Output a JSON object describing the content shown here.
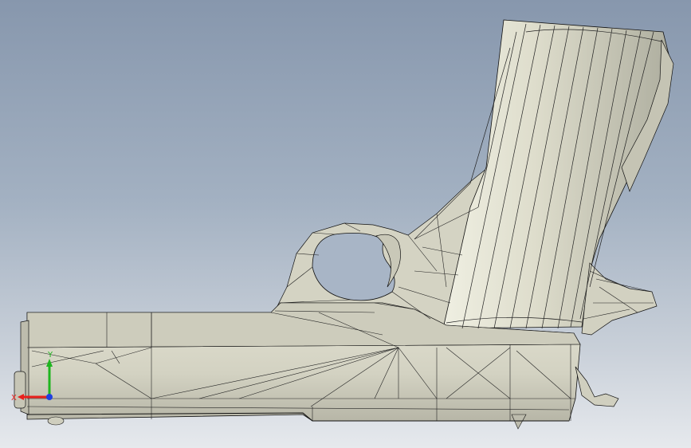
{
  "scene": {
    "model": "pistol-mesh",
    "render_style": "shaded-with-edges",
    "colors": {
      "background_top": "#8797ad",
      "background_bottom": "#e6e9ed",
      "surface": "#d6d5c6",
      "surface_shadow": "#aeae9f",
      "surface_highlight": "#efefe2",
      "edge": "#111111"
    }
  },
  "triad": {
    "x_label": "X",
    "y_label": "Y",
    "colors": {
      "x": "#e8201c",
      "y": "#1fb51f",
      "z": "#2040e0"
    }
  }
}
